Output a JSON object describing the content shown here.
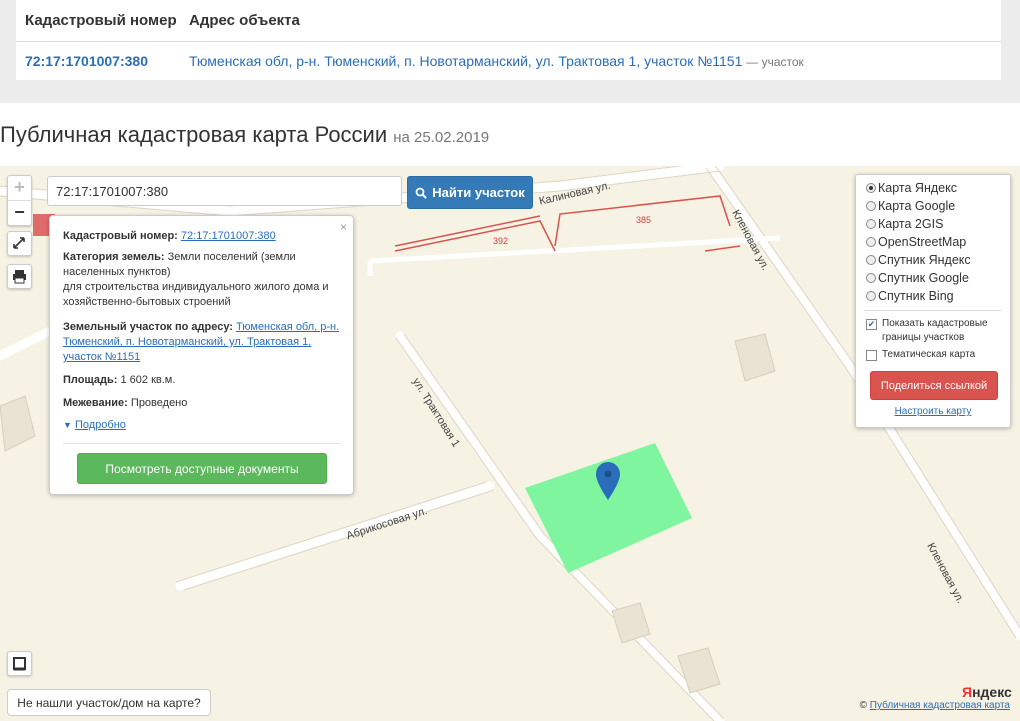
{
  "table": {
    "headers": [
      "Кадастровый номер",
      "Адрес объекта"
    ],
    "row": {
      "cadastral_number": "72:17:1701007:380",
      "address": "Тюменская обл, р-н. Тюменский, п. Новотарманский, ул. Трактовая 1, участок №1151",
      "type": "— участок"
    }
  },
  "page_title": {
    "text": "Публичная кадастровая карта России",
    "date": "на 25.02.2019"
  },
  "search": {
    "value": "72:17:1701007:380",
    "button_label": "Найти участок"
  },
  "zoom": {
    "plus": "+",
    "minus": "−"
  },
  "popup": {
    "close": "×",
    "cad_label": "Кадастровый номер:",
    "cad_value": "72:17:1701007:380",
    "category_label": "Категория земель:",
    "category_value": "Земли поселений (земли населенных пунктов)",
    "use_value": "для строительства индивидуального жилого дома и хозяйственно-бытовых строений",
    "address_label": "Земельный участок по адресу:",
    "address_value": "Тюменская обл, р-н. Тюменский, п. Новотарманский, ул. Трактовая 1, участок №1151",
    "area_label": "Площадь:",
    "area_value": "1 602 кв.м.",
    "survey_label": "Межевание:",
    "survey_value": "Проведено",
    "more_link": "Подробно",
    "docs_button": "Посмотреть доступные документы"
  },
  "layers": {
    "options": [
      "Карта Яндекс",
      "Карта Google",
      "Карта 2GIS",
      "OpenStreetMap",
      "Спутник Яндекс",
      "Спутник Google",
      "Спутник Bing"
    ],
    "selected": "Карта Яндекс",
    "show_borders_label": "Показать кадастровые границы участков",
    "show_borders_checked": true,
    "thematic_label": "Тематическая карта",
    "thematic_checked": false,
    "share_button": "Поделиться ссылкой",
    "configure_link": "Настроить карту"
  },
  "map": {
    "streets": [
      "Калиновая ул.",
      "Кленовая ул.",
      "ул. Трактовая 1",
      "Абрикосовая ул.",
      "Кленовая ул."
    ],
    "parcel_numbers": [
      "392",
      "385"
    ],
    "parcel_color": "#7ef59e",
    "boundary_color": "#d9534f",
    "marker_color": "#2a6ebb"
  },
  "not_found_button": "Не нашли участок/дом на карте?",
  "footer": {
    "copyright": "©",
    "link": "Публичная кадастровая карта"
  },
  "yandex_logo": {
    "first": "Я",
    "rest": "ндекс"
  }
}
